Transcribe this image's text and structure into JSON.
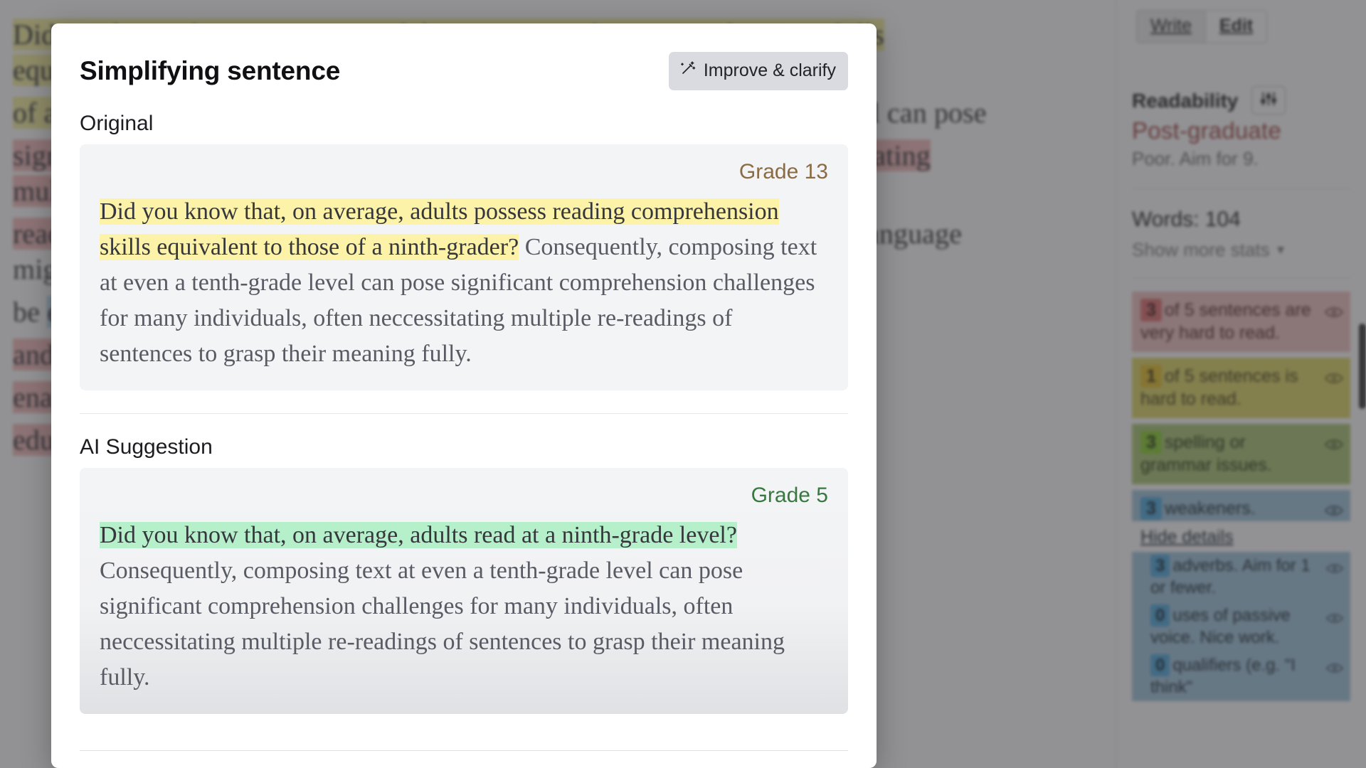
{
  "modal": {
    "title": "Simplifying sentence",
    "improve_button": {
      "label": "Improve & clarify",
      "icon": "magic-wand-icon"
    },
    "original": {
      "label": "Original",
      "grade": "Grade 13",
      "grade_color": "#8b6b43",
      "highlighted": "Did you know that, on average, adults possess reading comprehension skills equivalent to those of a ninth-grader?",
      "rest": " Consequently, composing text at even a tenth-grade level can pose significant comprehension challenges for many individuals, often neccessitating multiple re-readings of sentences to grasp their meaning fully.",
      "highlight_color": "#fdf3a8"
    },
    "suggestion": {
      "label": "AI Suggestion",
      "grade": "Grade 5",
      "grade_color": "#38793f",
      "highlighted": "Did you know that, on average, adults read at a ninth-grade level?",
      "rest": " Consequently, composing text at even a tenth-grade level can pose significant comprehension challenges for many individuals, often neccessitating multiple re-readings of sentences to grasp their meaning fully.",
      "highlight_color": "#b5f0cb"
    }
  },
  "rail": {
    "mode_toggle": {
      "write": "Write",
      "edit": "Edit",
      "active": "Write"
    },
    "readability": {
      "heading": "Readability",
      "settings_icon": "sliders-icon",
      "level": "Post-graduate",
      "level_color": "#9c3a3a",
      "hint": "Poor. Aim for 9."
    },
    "words": "Words: 104",
    "show_more_stats": "Show more stats",
    "caret_icon": "caret-down-icon",
    "stats": [
      {
        "count": "3",
        "text": "of 5 sentences are very hard to read.",
        "severity": "very-hard",
        "bg": "#f0c0c0",
        "badge": "#df6b6b",
        "eye_icon": "eye-icon"
      },
      {
        "count": "1",
        "text": "of 5 sentences is hard to read.",
        "severity": "hard",
        "bg": "#dfd55f",
        "badge": "#e4bd22",
        "eye_icon": "eye-icon"
      },
      {
        "count": "3",
        "text": "spelling or grammar issues.",
        "severity": "grammar",
        "bg": "#a8c470",
        "badge": "#86cc27",
        "eye_icon": "eye-icon"
      }
    ],
    "weakeners": {
      "count": "3",
      "text": "weakeners.",
      "toggle_label": "Hide details",
      "bg": "#9ec4dc",
      "badge": "#49a6dc",
      "eye_icon": "eye-icon",
      "details": [
        {
          "count": "3",
          "text": "adverbs. Aim for 1 or fewer.",
          "eye_icon": "eye-icon"
        },
        {
          "count": "0",
          "text": "uses of passive voice. Nice work.",
          "eye_icon": "eye-icon"
        },
        {
          "count": "0",
          "text": "qualifiers (e.g. \"I think\"",
          "eye_icon": "eye-icon"
        }
      ]
    }
  },
  "background_document": {
    "lines": [
      {
        "text": "Did you know that, on average, adults possess reading comprehension skills equivalent to those",
        "highlight": "yellow"
      },
      {
        "text": "of a ninth-grader? Consequently, composing text at even a tenth-grade level can pose",
        "highlight": "yellow"
      },
      {
        "text": "significant comprehension challenges for many individuals, often neccessitating multiple re-",
        "highlight": "red"
      },
      {
        "text": "readings of sentences to grasp their meaning fully. Furthermore, complex language might",
        "highlight": "red"
      },
      {
        "text": "be entirely inaccessible to readers with lower literacy levels, limiting their ability",
        "highlight": "blue"
      },
      {
        "text": "and clarity are paramount in written communication, thereby",
        "highlight": "red"
      },
      {
        "text": "enabling a broader audience to engage effectively with the content.",
        "highlight": "red"
      },
      {
        "text": "educators recommend simpler texts.",
        "highlight": "red"
      }
    ]
  }
}
